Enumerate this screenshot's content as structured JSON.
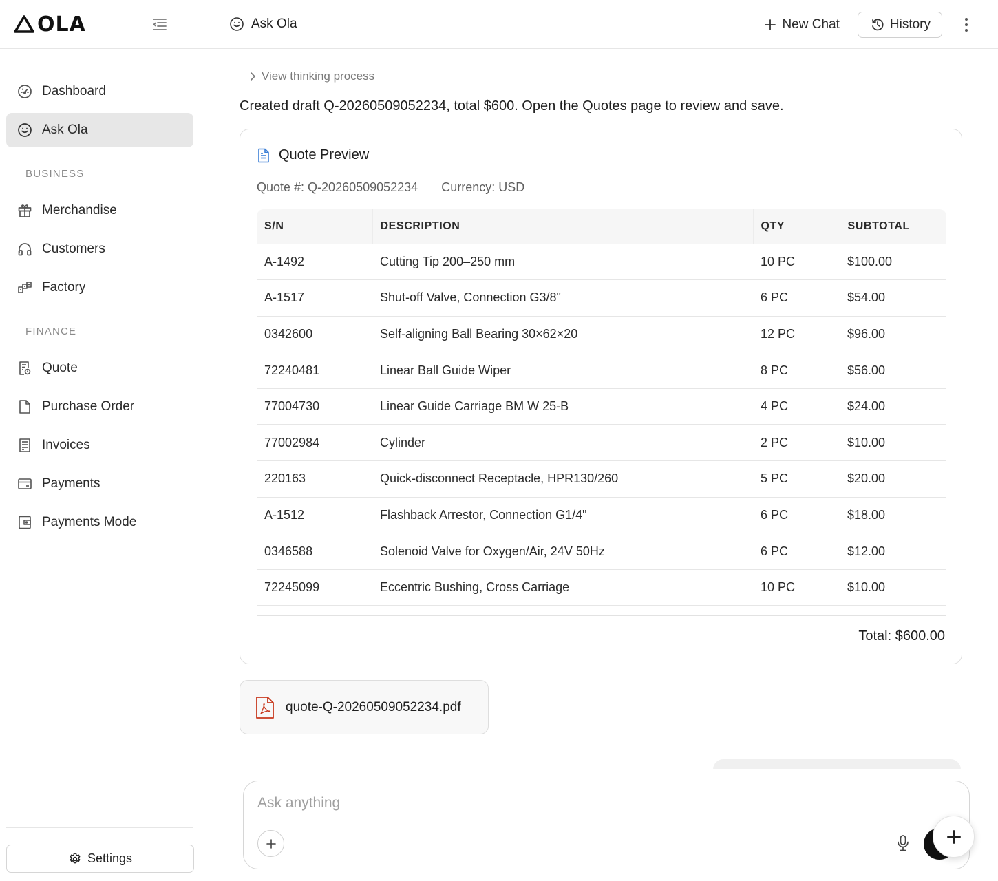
{
  "app": {
    "logo_text": "OLA"
  },
  "sidebar": {
    "items": [
      {
        "label": "Dashboard",
        "icon": "gauge-icon"
      },
      {
        "label": "Ask Ola",
        "icon": "smiley-icon",
        "active": true
      }
    ],
    "business_heading": "BUSINESS",
    "business_items": [
      {
        "label": "Merchandise",
        "icon": "gift-icon"
      },
      {
        "label": "Customers",
        "icon": "headphones-icon"
      },
      {
        "label": "Factory",
        "icon": "factory-icon"
      }
    ],
    "finance_heading": "FINANCE",
    "finance_items": [
      {
        "label": "Quote",
        "icon": "quote-doc-icon"
      },
      {
        "label": "Purchase Order",
        "icon": "file-icon"
      },
      {
        "label": "Invoices",
        "icon": "receipt-icon"
      },
      {
        "label": "Payments",
        "icon": "credit-card-icon"
      },
      {
        "label": "Payments Mode",
        "icon": "wallet-icon"
      }
    ],
    "settings_label": "Settings"
  },
  "header": {
    "title": "Ask Ola",
    "new_chat_label": "New Chat",
    "history_label": "History"
  },
  "chat": {
    "thinking_label": "View thinking process",
    "message": "Created draft Q-20260509052234, total $600. Open the Quotes page to review and save.",
    "quote": {
      "title": "Quote Preview",
      "number_text": "Quote #: Q-20260509052234",
      "currency_text": "Currency: USD",
      "columns": [
        "S/N",
        "DESCRIPTION",
        "QTY",
        "SUBTOTAL"
      ],
      "rows": [
        [
          "A-1492",
          "Cutting Tip 200–250 mm",
          "10 PC",
          "$100.00"
        ],
        [
          "A-1517",
          "Shut-off Valve, Connection G3/8\"",
          "6 PC",
          "$54.00"
        ],
        [
          "0342600",
          "Self-aligning Ball Bearing 30×62×20",
          "12 PC",
          "$96.00"
        ],
        [
          "72240481",
          "Linear Ball Guide Wiper",
          "8 PC",
          "$56.00"
        ],
        [
          "77004730",
          "Linear Guide Carriage BM W 25-B",
          "4 PC",
          "$24.00"
        ],
        [
          "77002984",
          "Cylinder",
          "2 PC",
          "$10.00"
        ],
        [
          "220163",
          "Quick-disconnect Receptacle, HPR130/260",
          "5 PC",
          "$20.00"
        ],
        [
          "A-1512",
          "Flashback Arrestor, Connection G1/4\"",
          "6 PC",
          "$18.00"
        ],
        [
          "0346588",
          "Solenoid Valve for Oxygen/Air, 24V 50Hz",
          "6 PC",
          "$12.00"
        ],
        [
          "72245099",
          "Eccentric Bushing, Cross Carriage",
          "10 PC",
          "$10.00"
        ]
      ],
      "total_text": "Total: $600.00"
    },
    "attachment_name": "quote-Q-20260509052234.pdf"
  },
  "composer": {
    "placeholder": "Ask anything"
  },
  "colors": {
    "doc_icon": "#3b7fd6",
    "pdf_icon": "#c8391e",
    "active_nav": "#e7e7e7"
  }
}
